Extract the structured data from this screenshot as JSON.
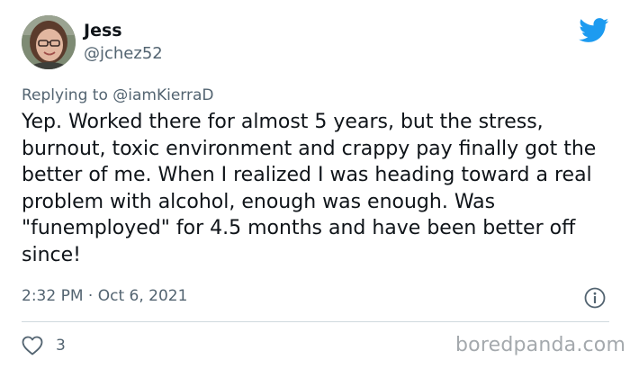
{
  "author": {
    "display_name": "Jess",
    "handle": "@jchez52"
  },
  "reply": {
    "prefix": "Replying to ",
    "mention": "@iamKierraD"
  },
  "tweet_text": "Yep. Worked there for almost 5 years, but the stress, burnout, toxic environment and crappy pay finally got the better of me. When I realized I was heading toward a real problem with alcohol, enough was enough. Was \"funemployed\" for 4.5 months and have been better off since!",
  "meta": {
    "time": "2:32 PM",
    "separator": " · ",
    "date": "Oct 6, 2021"
  },
  "stats": {
    "likes": "3"
  },
  "watermark": "boredpanda.com",
  "icons": {
    "brand": "twitter-bird-icon",
    "info": "info-icon",
    "like": "heart-icon"
  },
  "colors": {
    "twitter_blue": "#1d9bf0",
    "secondary_text": "#536471",
    "divider": "#cfd9de",
    "watermark": "#a4a9ad"
  }
}
